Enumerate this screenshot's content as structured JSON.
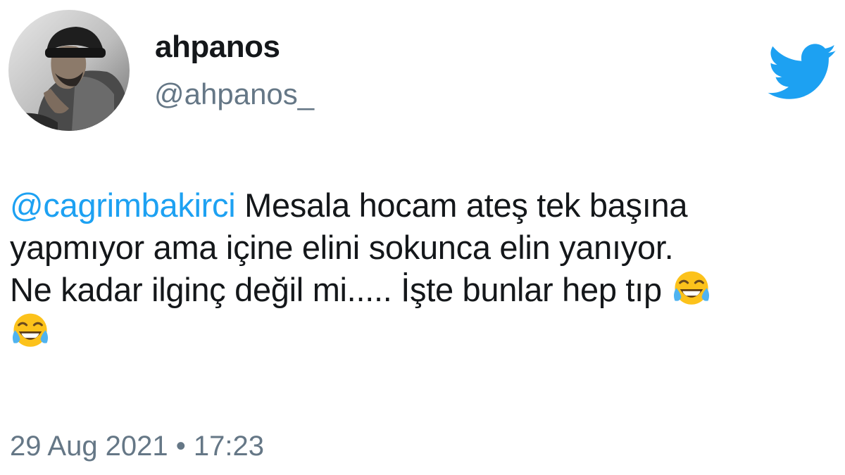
{
  "user": {
    "display_name": "ahpanos",
    "handle": "@ahpanos_"
  },
  "tweet": {
    "mention": "@cagrimbakirci",
    "text_line1": " Mesala hocam ateş tek başına",
    "text_line2": "yapmıyor ama içine elini sokunca elin yanıyor.",
    "text_line3": "Ne kadar ilginç değil mi..... İşte bunlar hep tıp ",
    "emojis": [
      "face-with-tears-of-joy",
      "face-with-tears-of-joy"
    ]
  },
  "timestamp": "29 Aug 2021 • 17:23",
  "colors": {
    "accent": "#1da1f2",
    "muted": "#657786",
    "text": "#14171a"
  },
  "icons": {
    "brand": "twitter-bird-icon"
  }
}
